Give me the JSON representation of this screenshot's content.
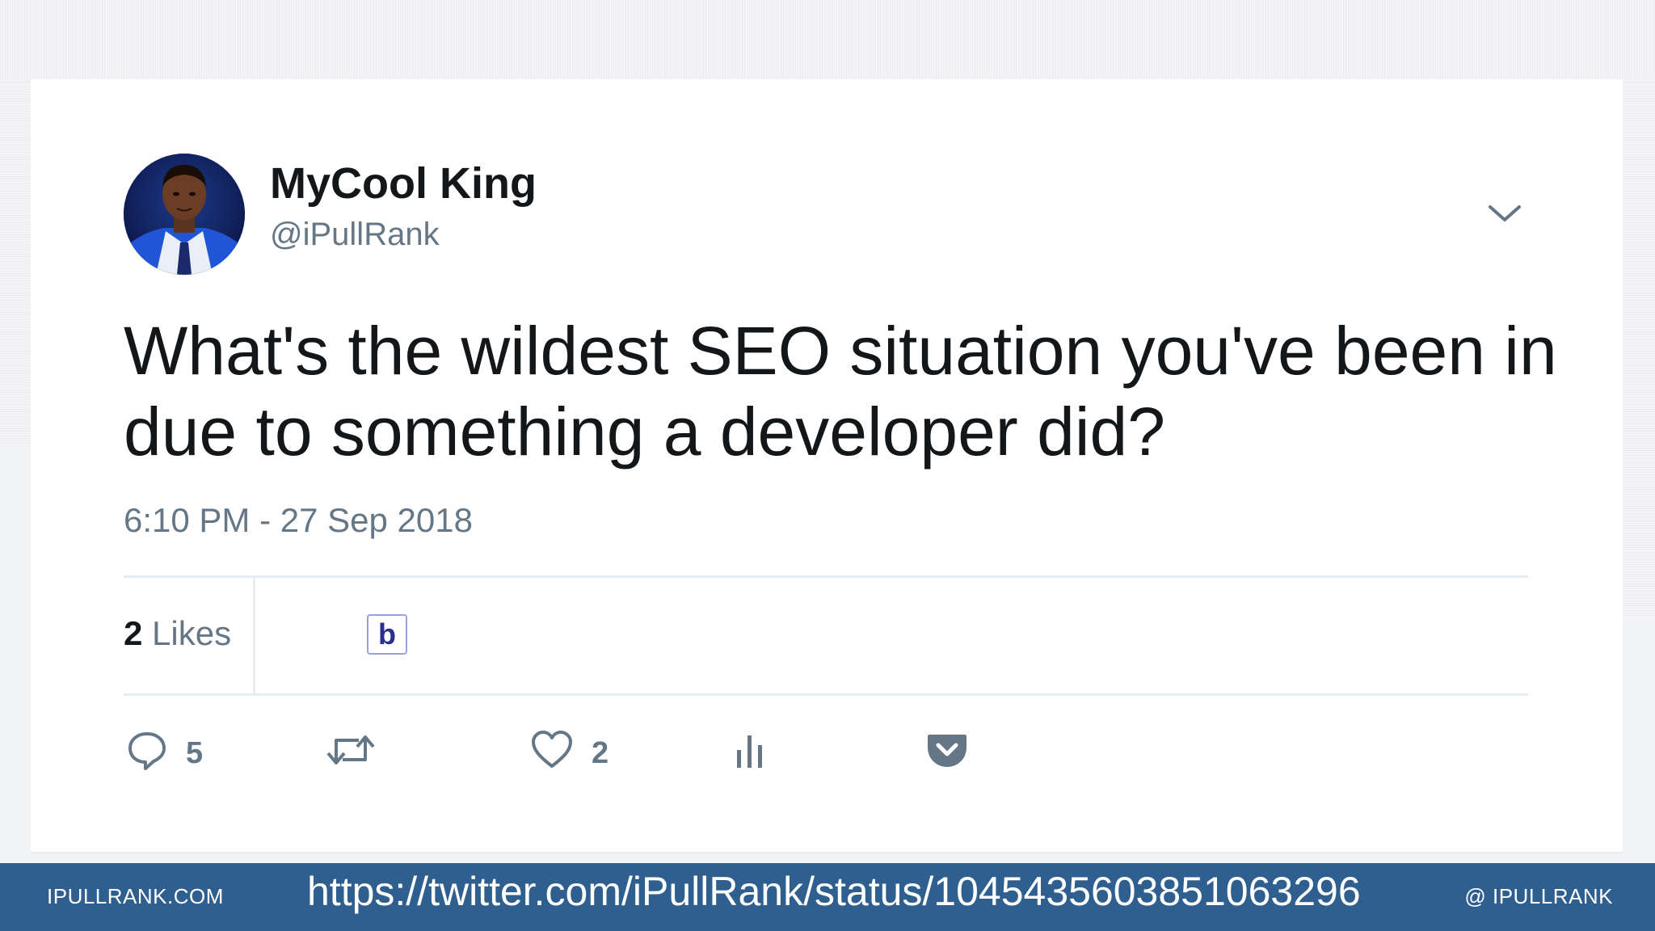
{
  "tweet": {
    "author_name": "MyCool King",
    "author_handle": "@iPullRank",
    "text": "What's the wildest SEO situation you've been in due to something a developer did?",
    "timestamp": "6:10 PM - 27 Sep 2018"
  },
  "stats": {
    "likes_count": "2",
    "likes_label": "Likes",
    "liker_avatar_letter": "b"
  },
  "actions": {
    "reply_count": "5",
    "retweet_count": "",
    "like_count": "2"
  },
  "colors": {
    "text_primary": "#14171a",
    "text_secondary": "#657786",
    "divider": "#e6ecf0",
    "footer_bg": "#2f5f8f",
    "pocket_icon": "#657786"
  },
  "footer": {
    "site": "IPULLRANK.COM",
    "url": "https://twitter.com/iPullRank/status/1045435603851063296",
    "handle": "@ IPULLRANK"
  }
}
